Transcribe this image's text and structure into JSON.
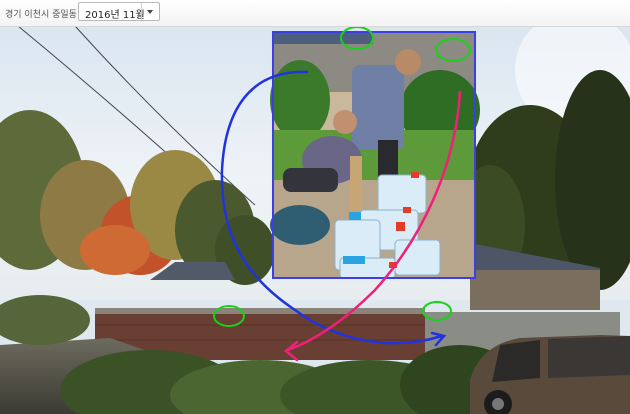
{
  "toolbar": {
    "location": "경기 이천시 중일동",
    "date_value": "2016년 11월",
    "dropdown_icon": "chevron-down-icon"
  },
  "colors": {
    "sky": "#e8f0f8",
    "foliage_dark": "#35471f",
    "foliage_autumn": "#c2522a",
    "inset_border": "#3a3fe8",
    "annotation_green": "#19d219",
    "annotation_blue": "#2233dd",
    "annotation_pink": "#f0207a"
  }
}
